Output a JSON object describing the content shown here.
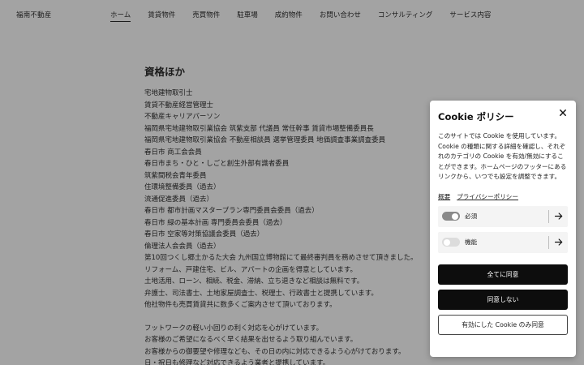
{
  "site": {
    "name": "福南不動産"
  },
  "nav": [
    {
      "label": "ホーム",
      "active": true
    },
    {
      "label": "賃貸物件",
      "active": false
    },
    {
      "label": "売買物件",
      "active": false
    },
    {
      "label": "駐車場",
      "active": false
    },
    {
      "label": "成約物件",
      "active": false
    },
    {
      "label": "お問い合わせ",
      "active": false
    },
    {
      "label": "コンサルティング",
      "active": false
    },
    {
      "label": "サービス内容",
      "active": false
    }
  ],
  "content": {
    "heading": "資格ほか",
    "lines": [
      "宅地建物取引士",
      "賃貸不動産経営管理士",
      "不動産キャリアパーソン",
      "福岡県宅地建物取引業協会 筑紫支部 代議員 常任幹事 賃貸市場整備委員長",
      "福岡県宅地建物取引業協会 不動産相談員 選挙管理委員 地価調査事業調査委員",
      "春日市 商工会会員",
      "春日市まち・ひと・しごと創生外部有識者委員",
      "筑紫間税会青年委員",
      "住環境整備委員（過去）",
      "流通促進委員（過去）",
      "春日市 都市計画マスタープラン専門委員会委員（過去）",
      "春日市 緑の基本計画 専門委員会委員（過去）",
      "春日市 空家等対策協議会委員（過去）",
      "倫理法人会会員（過去）",
      " 第10回つくし郷土かるた大会  九州国立博物館にて最終審判員を務めさせて頂きました。",
      "リフォーム、戸建住宅、ビル、アパートの企画を得意としています。",
      "土地活用、ローン、相続、税金、滞納、立ち退きなど相談は無料です。",
      "弁護士、司法書士、土地家屋調査士、税理士、行政書士と提携しています。",
      "他社物件も売買賃貸共に数多くご案内させて頂いております。"
    ],
    "lines2": [
      "フットワークの軽い小回りの利く対応を心がけています。",
      "お客様のご希望になるべく早く結果を出せるよう取り組んでいます。",
      "お客様からの御要望や修理なども、その日の内に対応できるよう心がけております。",
      "日・祝日も修理など対応できるよう業者と提携しています。"
    ]
  },
  "cookie": {
    "title": "Cookie ポリシー",
    "close_icon": "close-icon",
    "description": "このサイトでは Cookie を使用しています。Cookie の種類に関する詳細を確認し、それぞれのカテゴリの Cookie を有効/無効にすることができます。ホームページのフッターにあるリンクから、いつでも設定を調整できます。",
    "link_summary": "概要",
    "link_privacy": "プライバシーポリシー",
    "categories": [
      {
        "label": "必須",
        "enabled": true
      },
      {
        "label": "機能",
        "enabled": false
      }
    ],
    "accept_all": "全てに同意",
    "decline": "同意しない",
    "accept_selected": "有効にした Cookie のみ同意"
  },
  "colors": {
    "overlay_bg": "#a3a3a3",
    "button_dark": "#0d0d0d",
    "panel_bg": "#ffffff"
  }
}
